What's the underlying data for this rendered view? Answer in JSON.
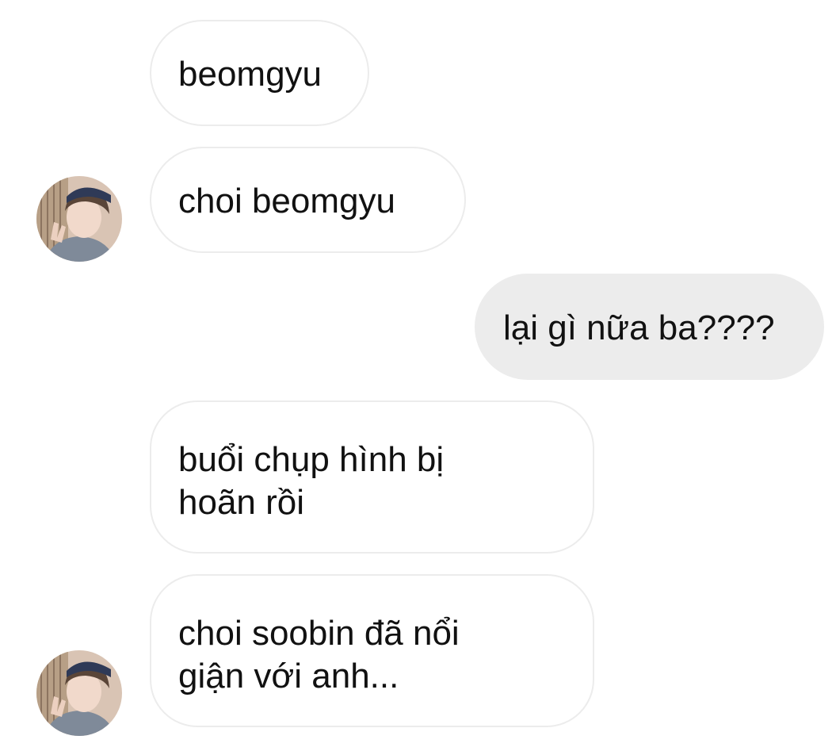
{
  "conversation": {
    "messages": [
      {
        "sender": "them",
        "lines": [
          "beomgyu"
        ]
      },
      {
        "sender": "them",
        "lines": [
          "choi beomgyu"
        ],
        "avatar": "profile-photo-icon"
      },
      {
        "sender": "me",
        "lines": [
          "lại gì nữa ba????"
        ]
      },
      {
        "sender": "them",
        "lines": [
          "buổi chụp hình bị",
          "hoãn rồi"
        ]
      },
      {
        "sender": "them",
        "lines": [
          "choi soobin đã nổi",
          "giận với anh..."
        ],
        "avatar": "profile-photo-icon"
      }
    ]
  },
  "colors": {
    "incoming_bubble_bg": "#ffffff",
    "incoming_bubble_border": "#ececec",
    "outgoing_bubble_bg": "#ececec",
    "text": "#111111"
  }
}
